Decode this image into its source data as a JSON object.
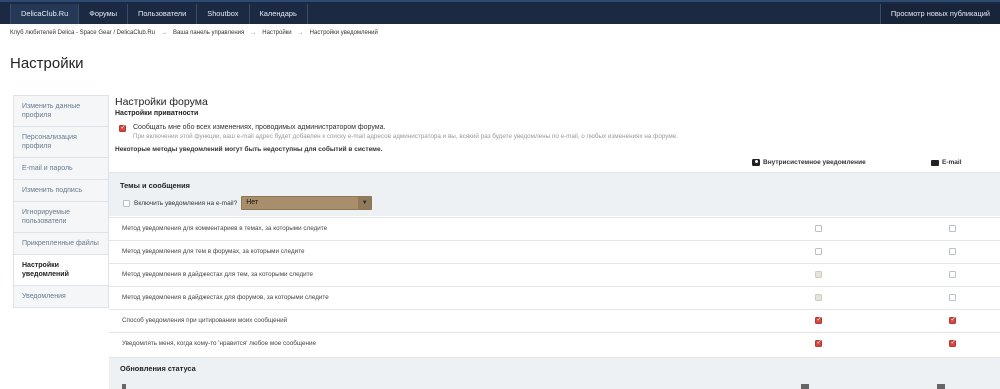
{
  "nav": {
    "items": [
      "DelicaClub.Ru",
      "Форумы",
      "Пользователи",
      "Shoutbox",
      "Календарь"
    ],
    "new_posts": "Просмотр новых публикаций"
  },
  "breadcrumb": [
    "Клуб любителей Delica - Space Gear / DelicaClub.Ru",
    "Ваша панель управления",
    "Настройки",
    "Настройки уведомлений"
  ],
  "breadcrumb_sep": "→",
  "page_title": "Настройки",
  "sidebar": {
    "items": [
      "Изменить данные профиля",
      "Персонализация профиля",
      "E-mail и пароль",
      "Изменить подпись",
      "Игнорируемые пользователи",
      "Прикрепленные файлы",
      "Настройки уведомлений",
      "Уведомления"
    ],
    "active_index": 6
  },
  "main": {
    "title": "Настройки форума",
    "privacy": {
      "title": "Настройки приватности",
      "option": "Сообщать мне обо всех изменениях, проводимых администратором форума.",
      "option_checked": true,
      "hint": "При включении этой функции, ваш e-mail адрес будет добавлен к списку e-mail адресов администратора и вы, всякий раз будете уведомлены по e-mail, о любых изменениях на форуме."
    },
    "methods_note": "Некоторые методы уведомлений могут быть недоступны для событий в системе.",
    "columns": {
      "app": "Внутрисистемное уведомление",
      "email": "E-mail"
    },
    "topics": {
      "title": "Темы и сообщения",
      "email_toggle_label": "Включить уведомления на e-mail?",
      "email_toggle_value": "Нет"
    },
    "rows": [
      {
        "label": "Метод уведомления для комментариев в темах, за которыми следите",
        "app": "unchecked",
        "email": "unchecked"
      },
      {
        "label": "Метод уведомления для тем в форумах, за которыми следите",
        "app": "unchecked",
        "email": "unchecked"
      },
      {
        "label": "Метод уведомления в дайджестах для тем, за которыми следите",
        "app": "disabled",
        "email": "unchecked"
      },
      {
        "label": "Метод уведомления в дайджестах для форумов, за которыми следите",
        "app": "disabled",
        "email": "unchecked"
      },
      {
        "label": "Способ уведомления при цитировании моих сообщений",
        "app": "checked",
        "email": "checked"
      },
      {
        "label": "Уведомлять меня, когда кому-то 'нравится' любое мое сообщение",
        "app": "checked",
        "email": "checked"
      }
    ],
    "status_group": {
      "title": "Обновления статуса"
    }
  },
  "colors": {
    "topbar": "#1b2a42",
    "checkbox_checked": "#d9463e",
    "select_bg": "#a88e6a",
    "group_bg": "#eef1f4"
  }
}
